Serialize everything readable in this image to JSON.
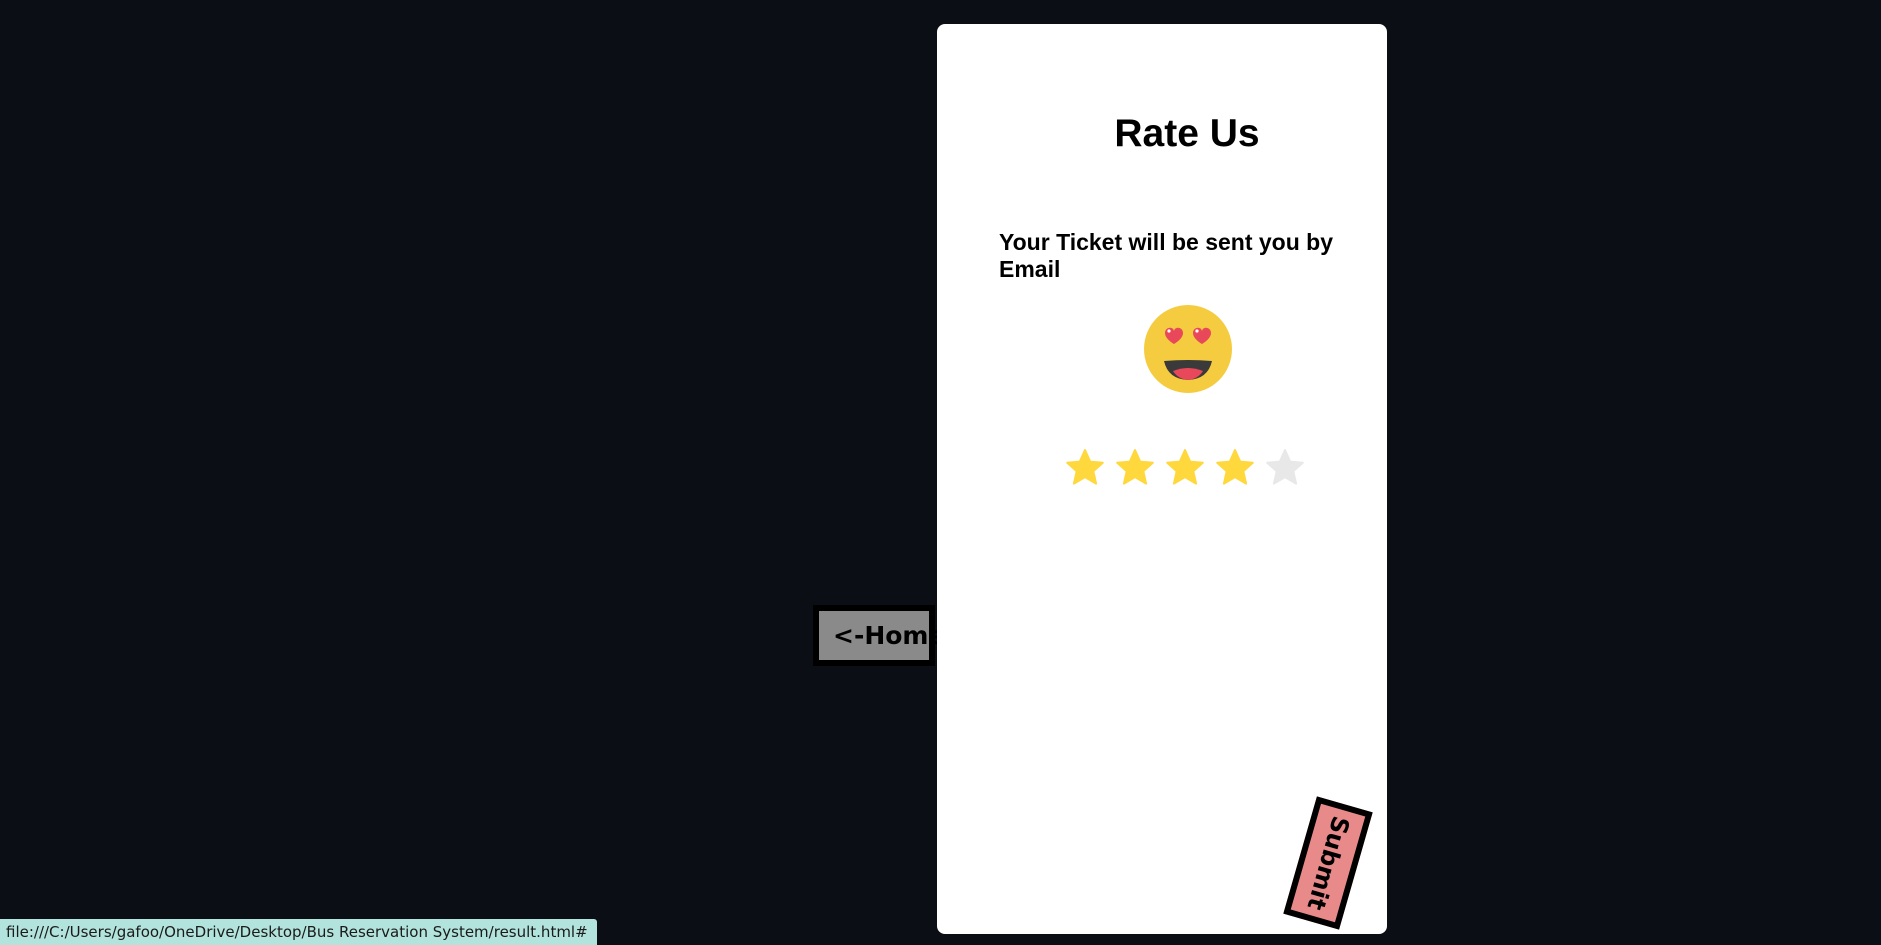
{
  "rating_card": {
    "title": "Rate Us",
    "message": "Your Ticket will be sent you by Email",
    "emoji": "heart-eyes-emoji",
    "rating": 4,
    "max_rating": 5,
    "star_active_color": "#FFD83D",
    "star_inactive_color": "#E8E8E8",
    "submit_label": "Submit"
  },
  "nav": {
    "home_label": "<-Home"
  },
  "status_bar": {
    "url": "file:///C:/Users/gafoo/OneDrive/Desktop/Bus Reservation System/result.html#"
  },
  "colors": {
    "background": "#0b0e15",
    "card": "#ffffff",
    "submit_button": "#e88a8a",
    "home_button": "#8a8a8a",
    "status_bar": "#b2e3dc"
  }
}
